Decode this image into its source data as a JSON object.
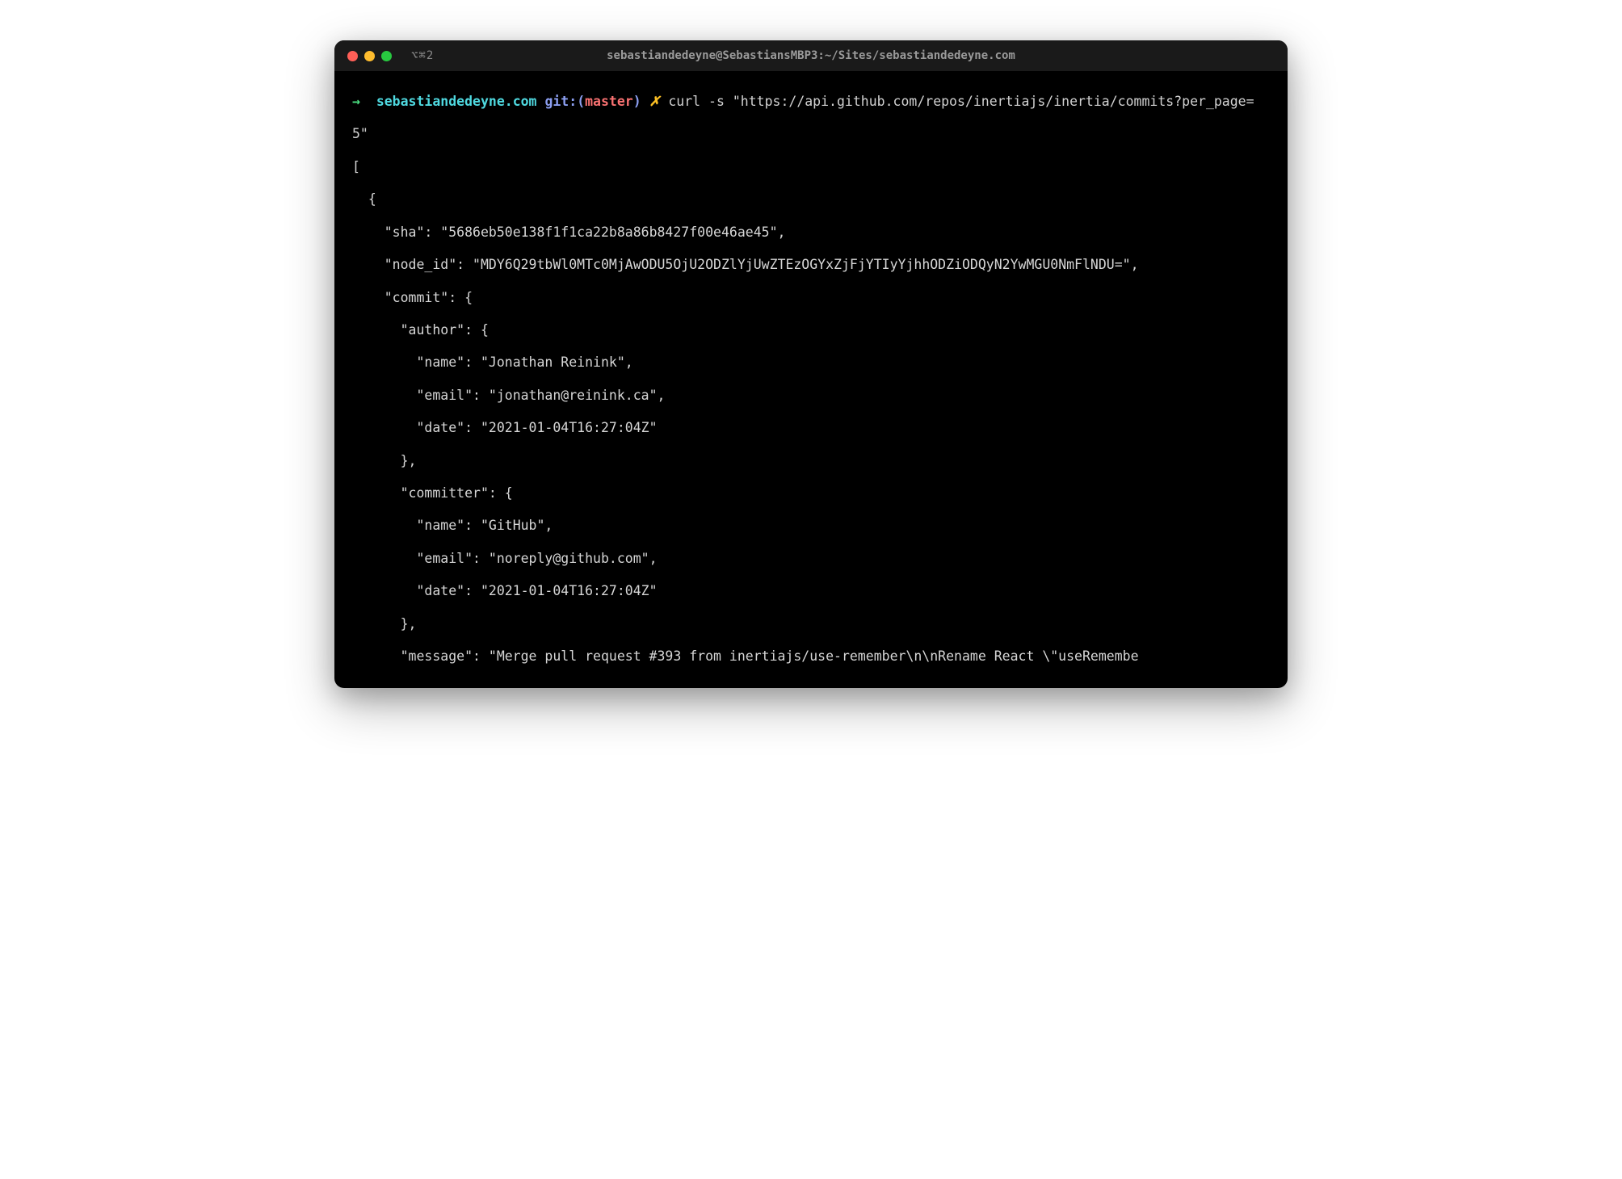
{
  "titlebar": {
    "tab_indicator": "⌥⌘2",
    "title": "sebastiandedeyne@SebastiansMBP3:~/Sites/sebastiandedeyne.com"
  },
  "prompt": {
    "arrow": "→",
    "dir": "sebastiandedeyne.com",
    "git_label": "git:",
    "branch": "master",
    "x": "✗"
  },
  "command": {
    "text": "curl -s \"https://api.github.com/repos/inertiajs/inertia/commits?per_page=5\""
  },
  "output": {
    "lines": [
      "[",
      "  {",
      "    \"sha\": \"5686eb50e138f1f1ca22b8a86b8427f00e46ae45\",",
      "    \"node_id\": \"MDY6Q29tbWl0MTc0MjAwODU5OjU2ODZlYjUwZTEzOGYxZjFjYTIyYjhhODZiODQyN2YwMGU0NmFlNDU=\",",
      "    \"commit\": {",
      "      \"author\": {",
      "        \"name\": \"Jonathan Reinink\",",
      "        \"email\": \"jonathan@reinink.ca\",",
      "        \"date\": \"2021-01-04T16:27:04Z\"",
      "      },",
      "      \"committer\": {",
      "        \"name\": \"GitHub\",",
      "        \"email\": \"noreply@github.com\",",
      "        \"date\": \"2021-01-04T16:27:04Z\"",
      "      },",
      "      \"message\": \"Merge pull request #393 from inertiajs/use-remember\\n\\nRename React \\\"useRemembe"
    ]
  }
}
